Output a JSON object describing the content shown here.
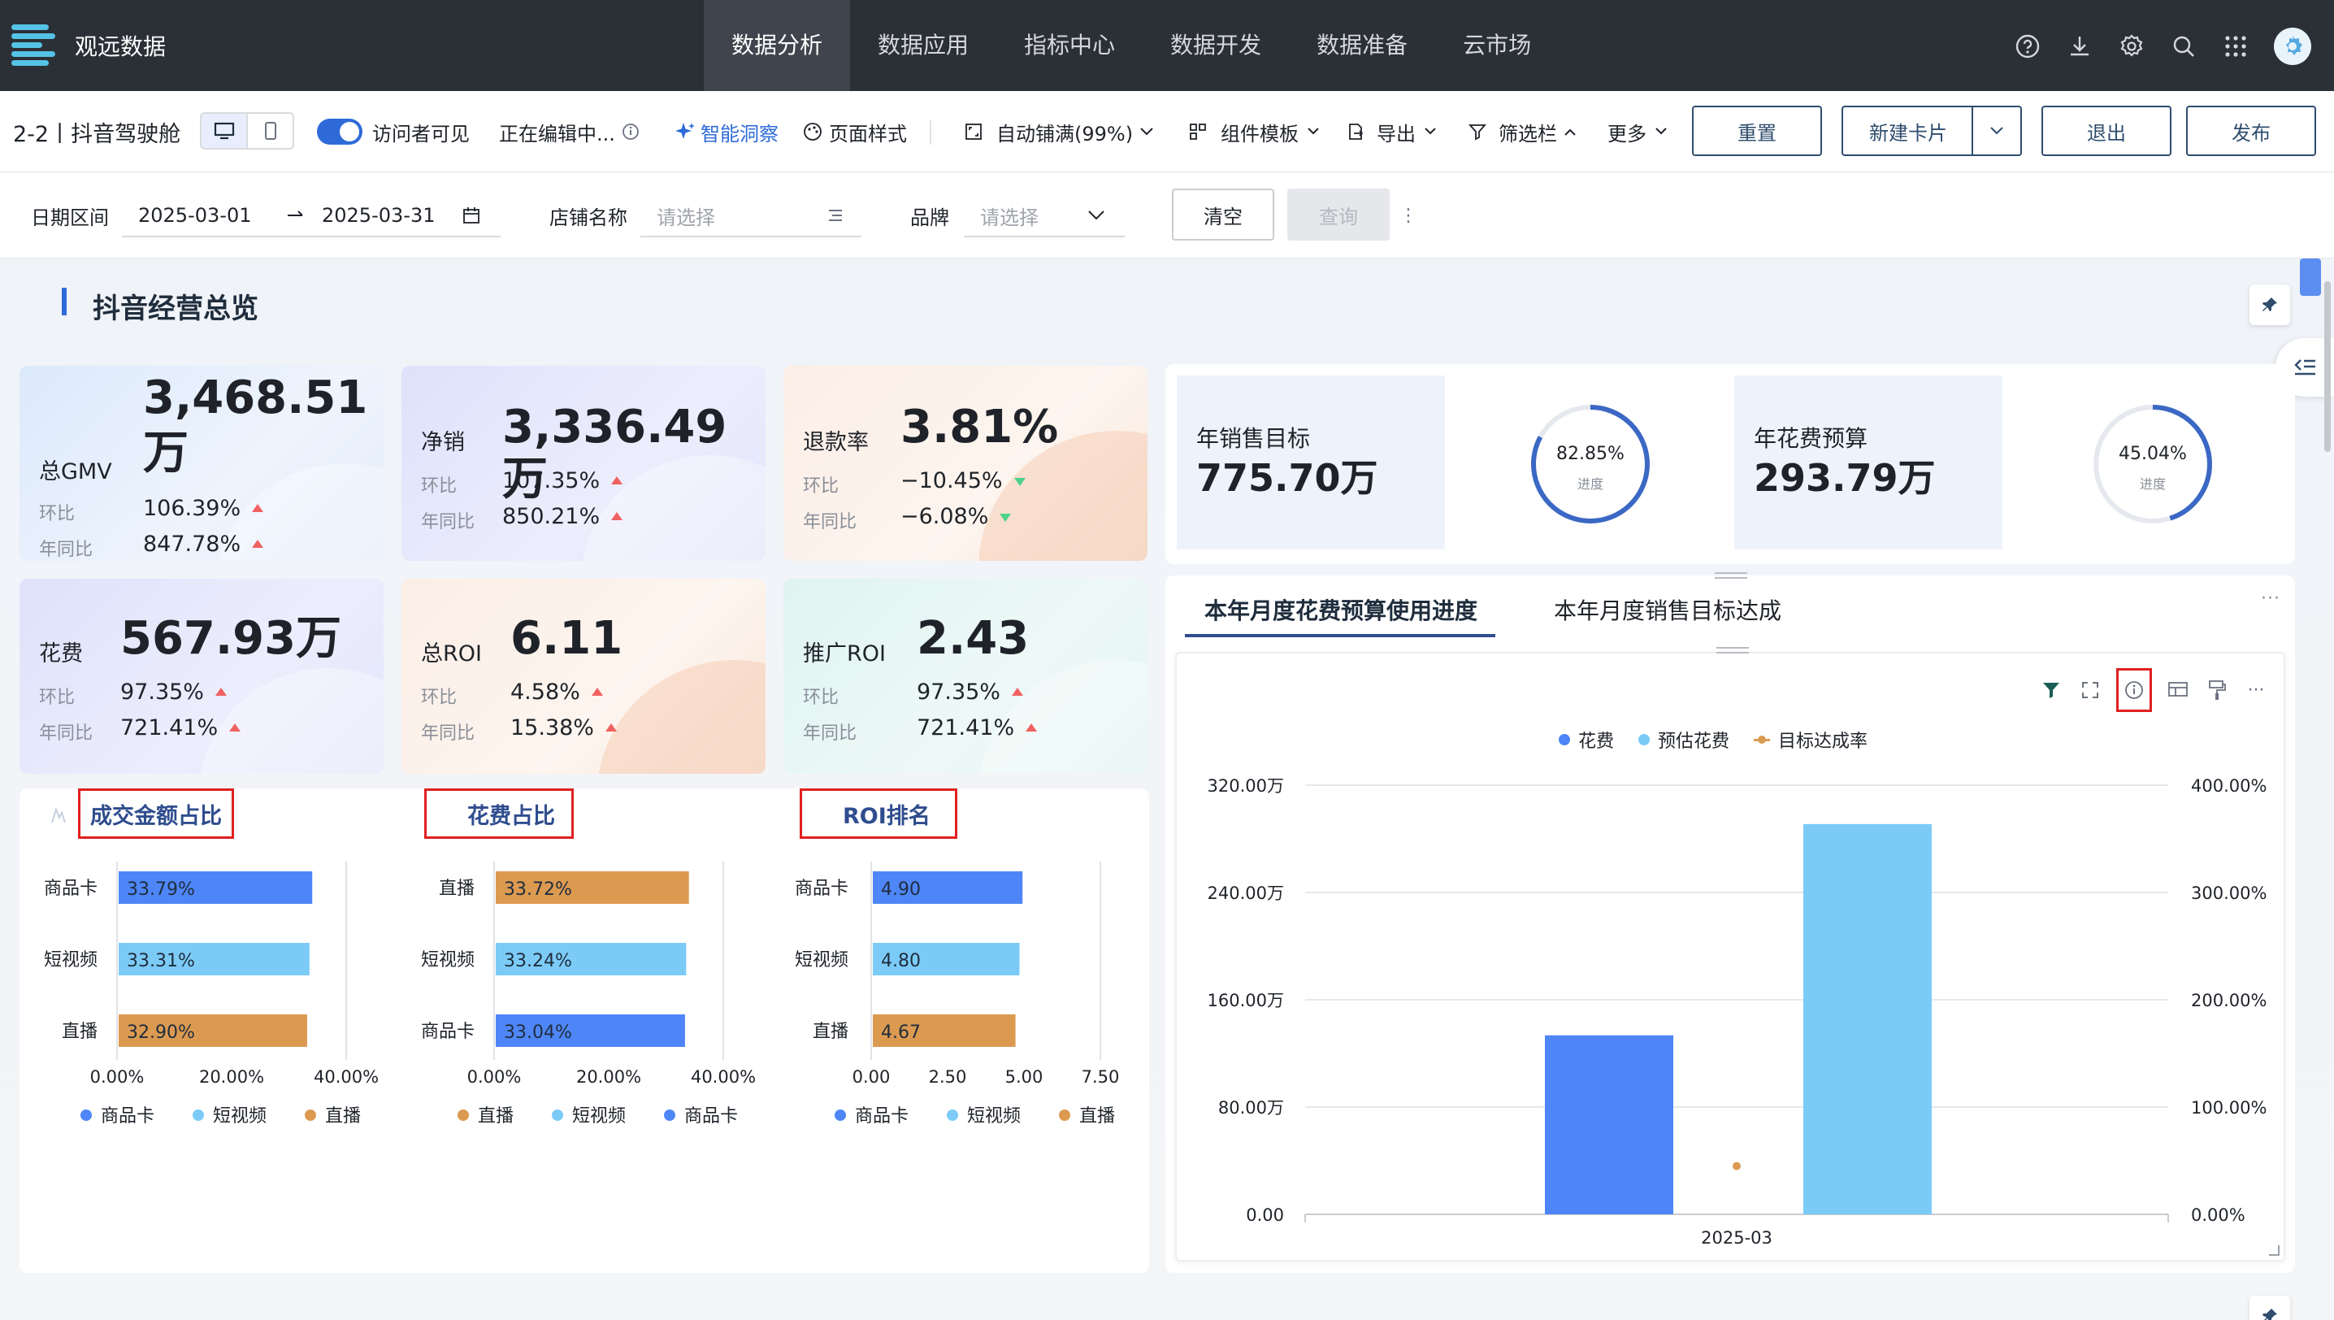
{
  "app": {
    "name": "观远数据"
  },
  "nav": {
    "items": [
      "数据分析",
      "数据应用",
      "指标中心",
      "数据开发",
      "数据准备",
      "云市场"
    ]
  },
  "toolbar": {
    "page_name": "2-2丨抖音驾驶舱",
    "visitor_visible": "访问者可见",
    "editing": "正在编辑中...",
    "insight": "智能洞察",
    "page_style": "页面样式",
    "auto_fit": "自动铺满(99%)",
    "templates": "组件模板",
    "export": "导出",
    "filter_bar": "筛选栏",
    "more": "更多",
    "reset": "重置",
    "new_card": "新建卡片",
    "exit": "退出",
    "publish": "发布"
  },
  "filters": {
    "date_label": "日期区间",
    "date_start": "2025-03-01",
    "date_end": "2025-03-31",
    "shop_label": "店铺名称",
    "shop_placeholder": "请选择",
    "brand_label": "品牌",
    "brand_placeholder": "请选择",
    "clear": "清空",
    "query": "查询"
  },
  "section": {
    "title": "抖音经营总览"
  },
  "kpis": [
    {
      "label": "总GMV",
      "value_line1": "3,468.51",
      "value_line2": "万",
      "mom_label": "环比",
      "mom": "106.39%",
      "yoy_label": "年同比",
      "yoy": "847.78%"
    },
    {
      "label": "净销",
      "value": "3,336.49万",
      "mom_label": "环比",
      "mom": "107.35%",
      "yoy_label": "年同比",
      "yoy": "850.21%"
    },
    {
      "label": "退款率",
      "value": "3.81%",
      "mom_label": "环比",
      "mom": "−10.45%",
      "yoy_label": "年同比",
      "yoy": "−6.08%"
    },
    {
      "label": "花费",
      "value": "567.93万",
      "mom_label": "环比",
      "mom": "97.35%",
      "yoy_label": "年同比",
      "yoy": "721.41%"
    },
    {
      "label": "总ROI",
      "value": "6.11",
      "mom_label": "环比",
      "mom": "4.58%",
      "yoy_label": "年同比",
      "yoy": "15.38%"
    },
    {
      "label": "推广ROI",
      "value": "2.43",
      "mom_label": "环比",
      "mom": "97.35%",
      "yoy_label": "年同比",
      "yoy": "721.41%"
    }
  ],
  "targets": [
    {
      "label": "年销售目标",
      "value": "775.70万",
      "progress_text": "82.85%",
      "progress_label": "进度",
      "progress": 0.8285
    },
    {
      "label": "年花费预算",
      "value": "293.79万",
      "progress_text": "45.04%",
      "progress_label": "进度",
      "progress": 0.4504
    }
  ],
  "colors": {
    "blue": "#4f86f7",
    "light_blue": "#7ccbf7",
    "orange": "#dc9a51",
    "accent": "#2f4d8e"
  },
  "chart_data": [
    {
      "type": "bar",
      "orientation": "horizontal",
      "title": "成交金额占比",
      "categories": [
        "商品卡",
        "短视频",
        "直播"
      ],
      "values": [
        33.79,
        33.31,
        32.9
      ],
      "labels": [
        "33.79%",
        "33.31%",
        "32.90%"
      ],
      "xlim": [
        0,
        40
      ],
      "x_ticks": [
        "0.00%",
        "20.00%",
        "40.00%"
      ],
      "legend": [
        "商品卡",
        "短视频",
        "直播"
      ],
      "legend_position": "bottom"
    },
    {
      "type": "bar",
      "orientation": "horizontal",
      "title": "花费占比",
      "categories": [
        "直播",
        "短视频",
        "商品卡"
      ],
      "values": [
        33.72,
        33.24,
        33.04
      ],
      "labels": [
        "33.72%",
        "33.24%",
        "33.04%"
      ],
      "xlim": [
        0,
        40
      ],
      "x_ticks": [
        "0.00%",
        "20.00%",
        "40.00%"
      ],
      "legend": [
        "直播",
        "短视频",
        "商品卡"
      ],
      "legend_position": "bottom"
    },
    {
      "type": "bar",
      "orientation": "horizontal",
      "title": "ROI排名",
      "categories": [
        "商品卡",
        "短视频",
        "直播"
      ],
      "values": [
        4.9,
        4.8,
        4.67
      ],
      "labels": [
        "4.90",
        "4.80",
        "4.67"
      ],
      "xlim": [
        0,
        7.5
      ],
      "x_ticks": [
        "0.00",
        "2.50",
        "5.00",
        "7.50"
      ],
      "legend": [
        "商品卡",
        "短视频",
        "直播"
      ],
      "legend_position": "bottom"
    },
    {
      "type": "bar",
      "tabs": [
        "本年月度花费预算使用进度",
        "本年月度销售目标达成"
      ],
      "categories": [
        "2025-03"
      ],
      "series": [
        {
          "name": "花费",
          "values": [
            133.5
          ],
          "axis": "left"
        },
        {
          "name": "预估花费",
          "values": [
            291.0
          ],
          "axis": "left"
        },
        {
          "name": "目标达成率",
          "values": [
            45.0
          ],
          "axis": "right",
          "marker": "point"
        }
      ],
      "ylim_left": [
        0,
        320
      ],
      "y_ticks_left": [
        "0.00",
        "80.00万",
        "160.00万",
        "240.00万",
        "320.00万"
      ],
      "ylim_right": [
        0,
        400
      ],
      "y_ticks_right": [
        "0.00%",
        "100.00%",
        "200.00%",
        "300.00%",
        "400.00%"
      ],
      "legend_position": "top"
    }
  ]
}
